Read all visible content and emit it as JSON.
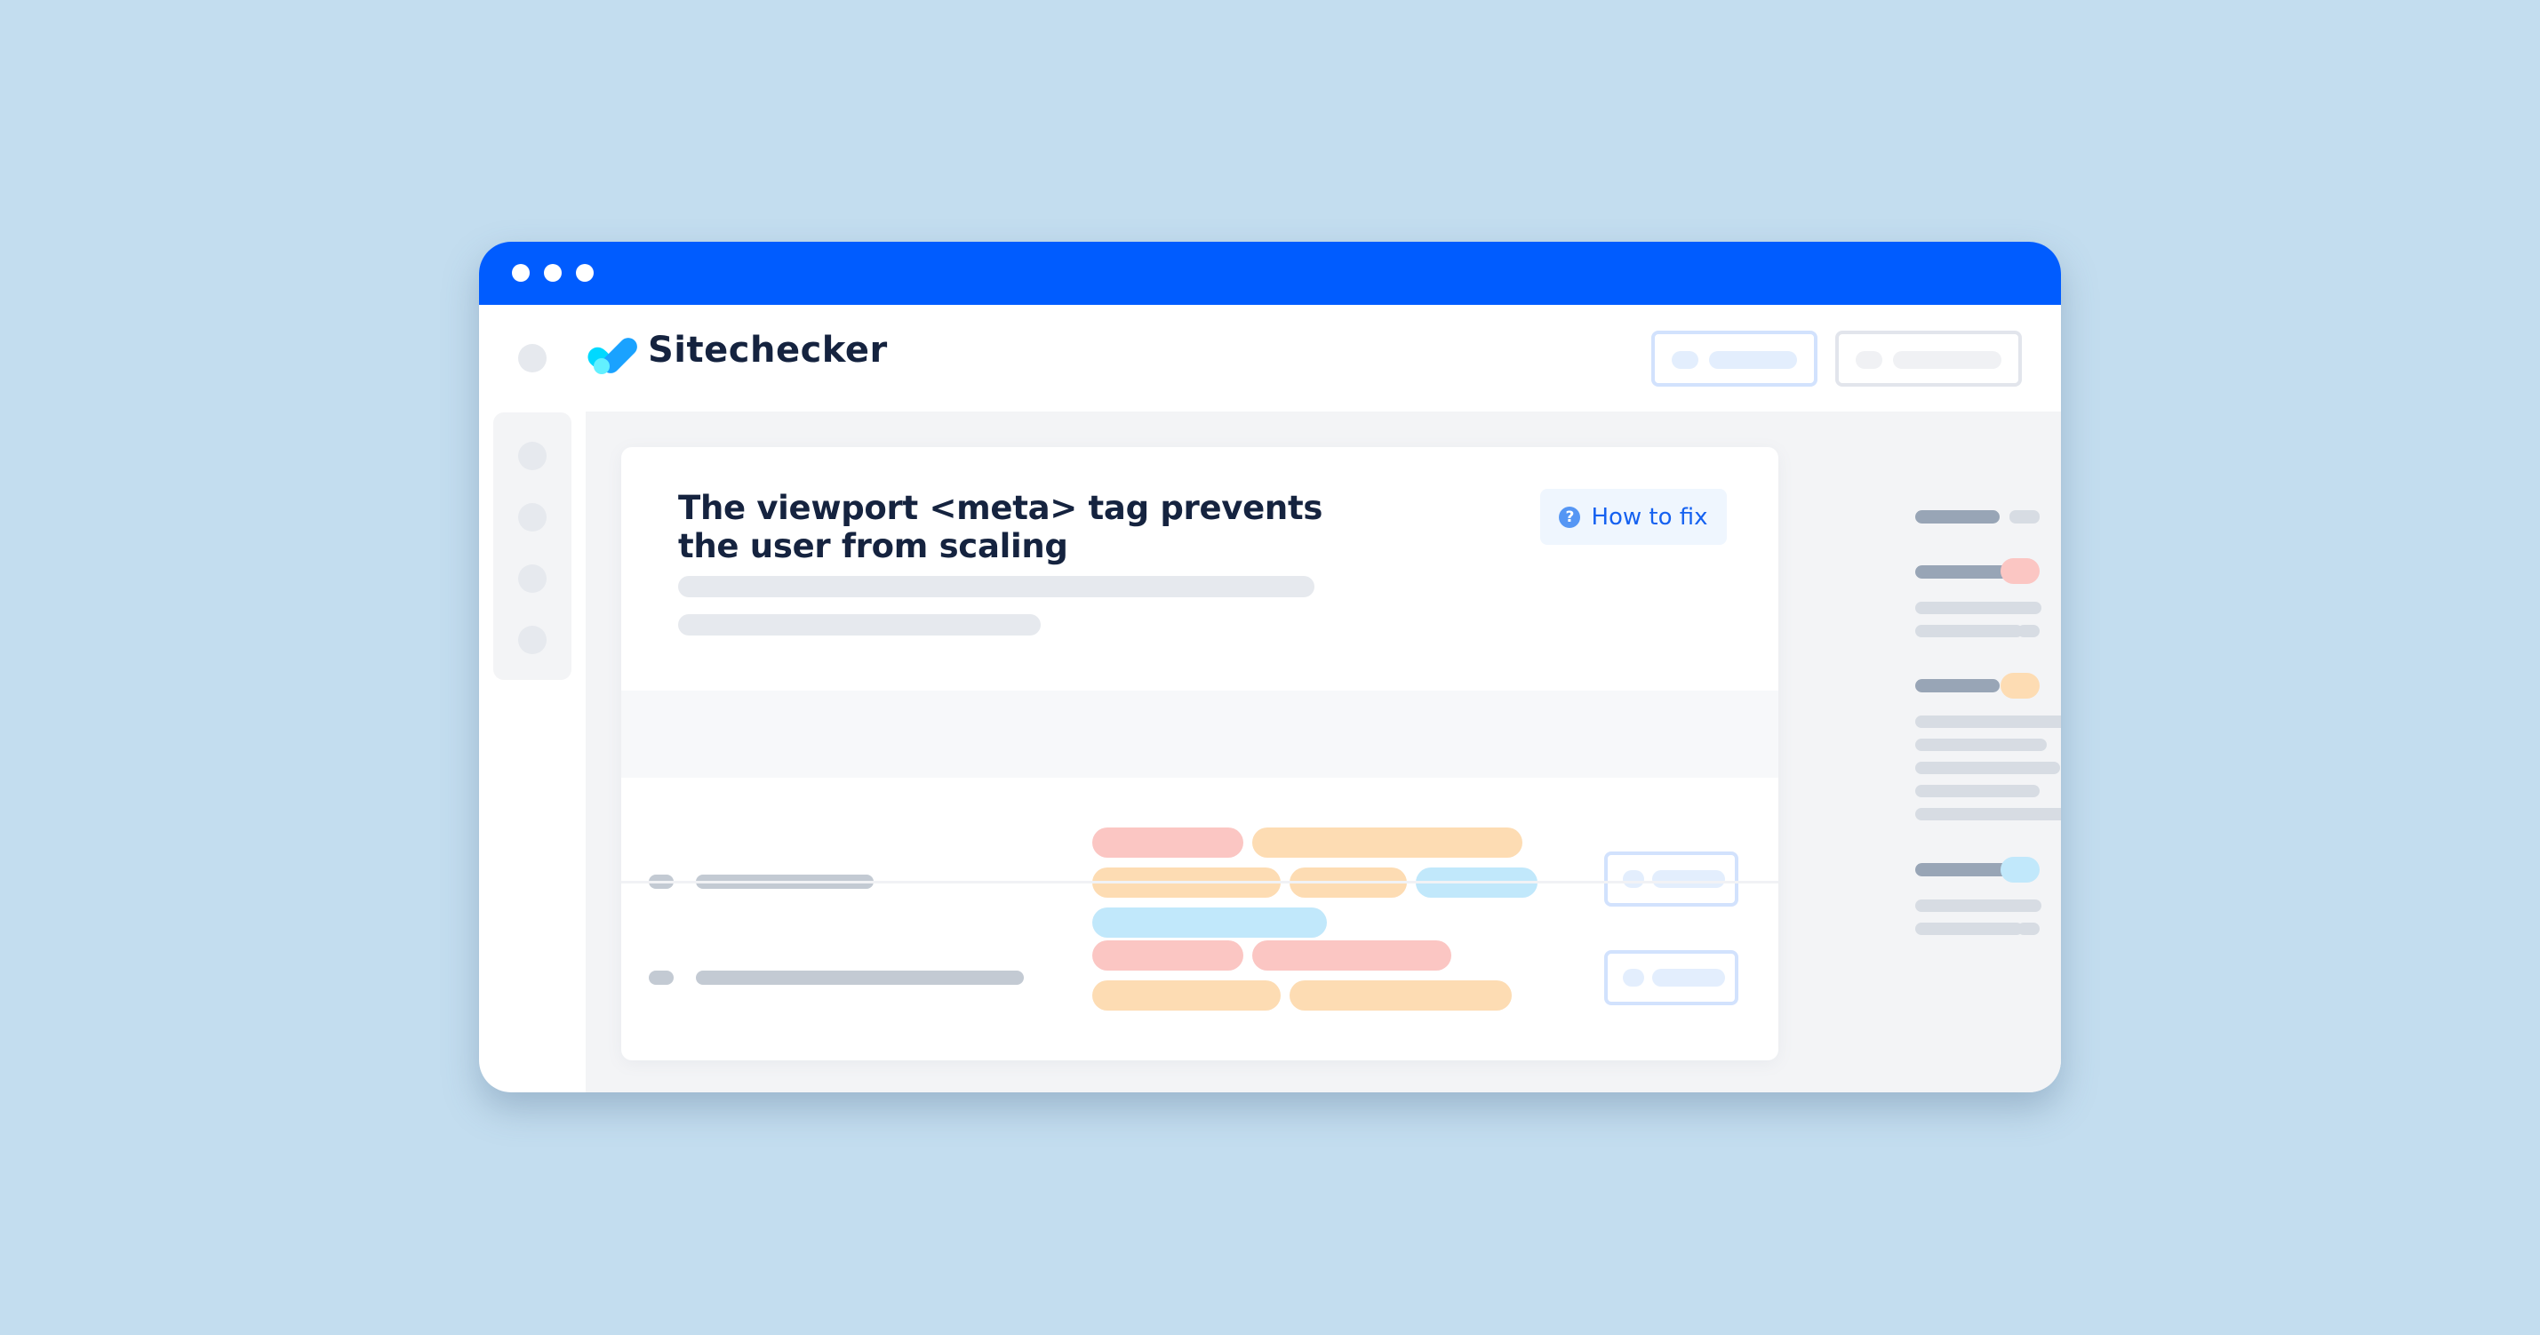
{
  "window": {
    "title_dots": [
      "close",
      "minimize",
      "maximize"
    ],
    "colors": {
      "titlebar": "#005cff",
      "background": "#c3ddef"
    }
  },
  "header": {
    "brand_name": "Sitechecker",
    "logo_icon": "checkmark-logo-icon",
    "buttons": [
      {
        "name": "primary-header-button",
        "style": "outlined-blue"
      },
      {
        "name": "secondary-header-button",
        "style": "outlined-gray"
      }
    ]
  },
  "left_rail": {
    "items": [
      "nav-item-1",
      "nav-item-2",
      "nav-item-3",
      "nav-item-4"
    ]
  },
  "issue": {
    "title": "The viewport <meta> tag prevents the user from scaling",
    "how_to_fix_label": "How to fix",
    "how_to_fix_icon": "?",
    "accent_color": "#1561f0"
  },
  "table": {
    "rows": [
      {
        "tags": [
          [
            "red",
            "orange"
          ],
          [
            "orange",
            "orange",
            "blue"
          ],
          [
            "blue"
          ]
        ]
      },
      {
        "tags": [
          [
            "red",
            "red"
          ],
          [
            "orange",
            "orange"
          ]
        ]
      }
    ],
    "tag_colors": {
      "red": "#fbc6c3",
      "orange": "#fddcb3",
      "blue": "#c1e8fb"
    }
  },
  "right_panel": {
    "groups": [
      {
        "badge": "neutral",
        "items": 0
      },
      {
        "badge": "red",
        "items": 2
      },
      {
        "badge": "orange",
        "items": 5
      },
      {
        "badge": "blue",
        "items": 2
      }
    ]
  }
}
